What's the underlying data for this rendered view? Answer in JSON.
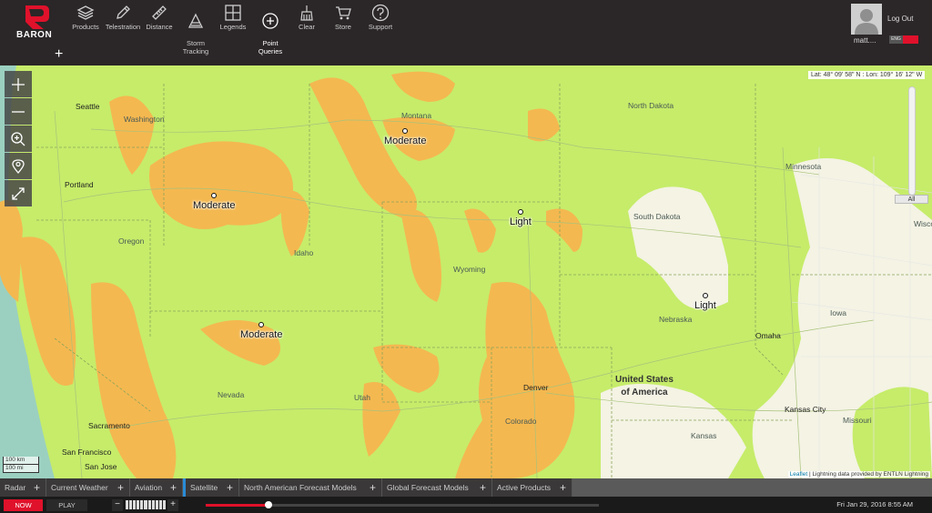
{
  "app": {
    "brand": "BARON"
  },
  "toolbar": {
    "items": [
      {
        "label": "Products",
        "icon": "layers-icon"
      },
      {
        "label": "Telestration",
        "icon": "pencil-icon"
      },
      {
        "label": "Distance",
        "icon": "ruler-icon"
      },
      {
        "label": "Storm\nTracking",
        "icon": "storm-tracking-icon"
      },
      {
        "label": "Legends",
        "icon": "legends-grid-icon"
      },
      {
        "label": "Point\nQueries",
        "icon": "crosshair-icon"
      },
      {
        "label": "Clear",
        "icon": "broom-icon"
      },
      {
        "label": "Store",
        "icon": "cart-icon"
      },
      {
        "label": "Support",
        "icon": "question-icon"
      }
    ],
    "add_symbol": "+"
  },
  "user": {
    "name": "matt....",
    "logout_label": "Log Out",
    "lang_label": "ENG"
  },
  "map": {
    "latlon": "Lat: 48° 09' 58\" N : Lon: 109° 16' 12\" W",
    "slider_label": "All",
    "scale": [
      "100 km",
      "100 mi"
    ],
    "attribution": {
      "leaflet": "Leaflet",
      "rest": " | Lightning data provided by ENTLN Lightning"
    },
    "states": [
      "Washington",
      "Oregon",
      "Idaho",
      "Montana",
      "Wyoming",
      "North Dakota",
      "South Dakota",
      "Nebraska",
      "Nevada",
      "Utah",
      "Colorado",
      "Kansas",
      "Minnesota",
      "Iowa",
      "Missouri",
      "Wisco"
    ],
    "cities": [
      "Seattle",
      "Portland",
      "Sacramento",
      "San Francisco",
      "San Jose",
      "Denver",
      "Omaha",
      "Kansas City"
    ],
    "country": "United States\nof America",
    "queries": [
      "Moderate",
      "Moderate",
      "Moderate",
      "Light",
      "Light"
    ],
    "colors": {
      "land": "#c6ec6a",
      "moderate": "#f4b850",
      "light_area": "#f4f3e4",
      "boundary": "#8aa45a"
    }
  },
  "tabs": [
    {
      "label": "Radar"
    },
    {
      "label": "Current Weather"
    },
    {
      "label": "Aviation"
    },
    {
      "label": "Satellite"
    },
    {
      "label": "North American Forecast Models"
    },
    {
      "label": "Global Forecast Models"
    },
    {
      "label": "Active Products"
    }
  ],
  "playback": {
    "now_label": "NOW",
    "play_label": "PLAY",
    "minus": "−",
    "plus": "+",
    "progress": 0.16,
    "datetime": "Fri Jan 29, 2016 8:55 AM"
  }
}
